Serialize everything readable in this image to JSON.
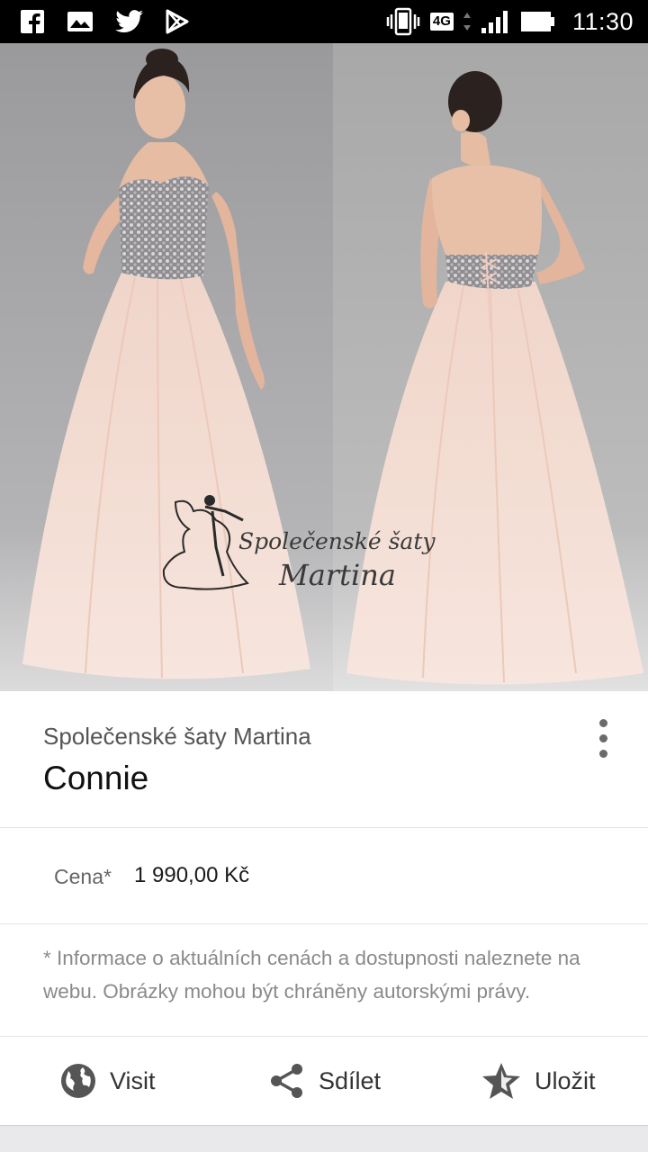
{
  "status_bar": {
    "time": "11:30",
    "network": "4G",
    "left_icons": [
      "facebook-icon",
      "image-icon",
      "twitter-icon",
      "play-store-icon"
    ],
    "right_icons": [
      "vibrate-icon",
      "signal-icon",
      "battery-icon"
    ]
  },
  "hero": {
    "watermark_line1": "Společenské šaty",
    "watermark_line2": "Martina"
  },
  "product": {
    "seller": "Společenské šaty Martina",
    "title": "Connie"
  },
  "price": {
    "label": "Cena*",
    "value": "1 990,00 Kč"
  },
  "disclaimer": "* Informace o aktuálních cenách a dostupnosti naleznete na webu. Obrázky mohou být chráněny autorskými právy.",
  "actions": {
    "visit": "Visit",
    "share": "Sdílet",
    "save": "Uložit"
  },
  "colors": {
    "status_bar": "#000000",
    "card": "#ffffff",
    "icon_gray": "#555555",
    "dress": "#f4d9cc"
  }
}
